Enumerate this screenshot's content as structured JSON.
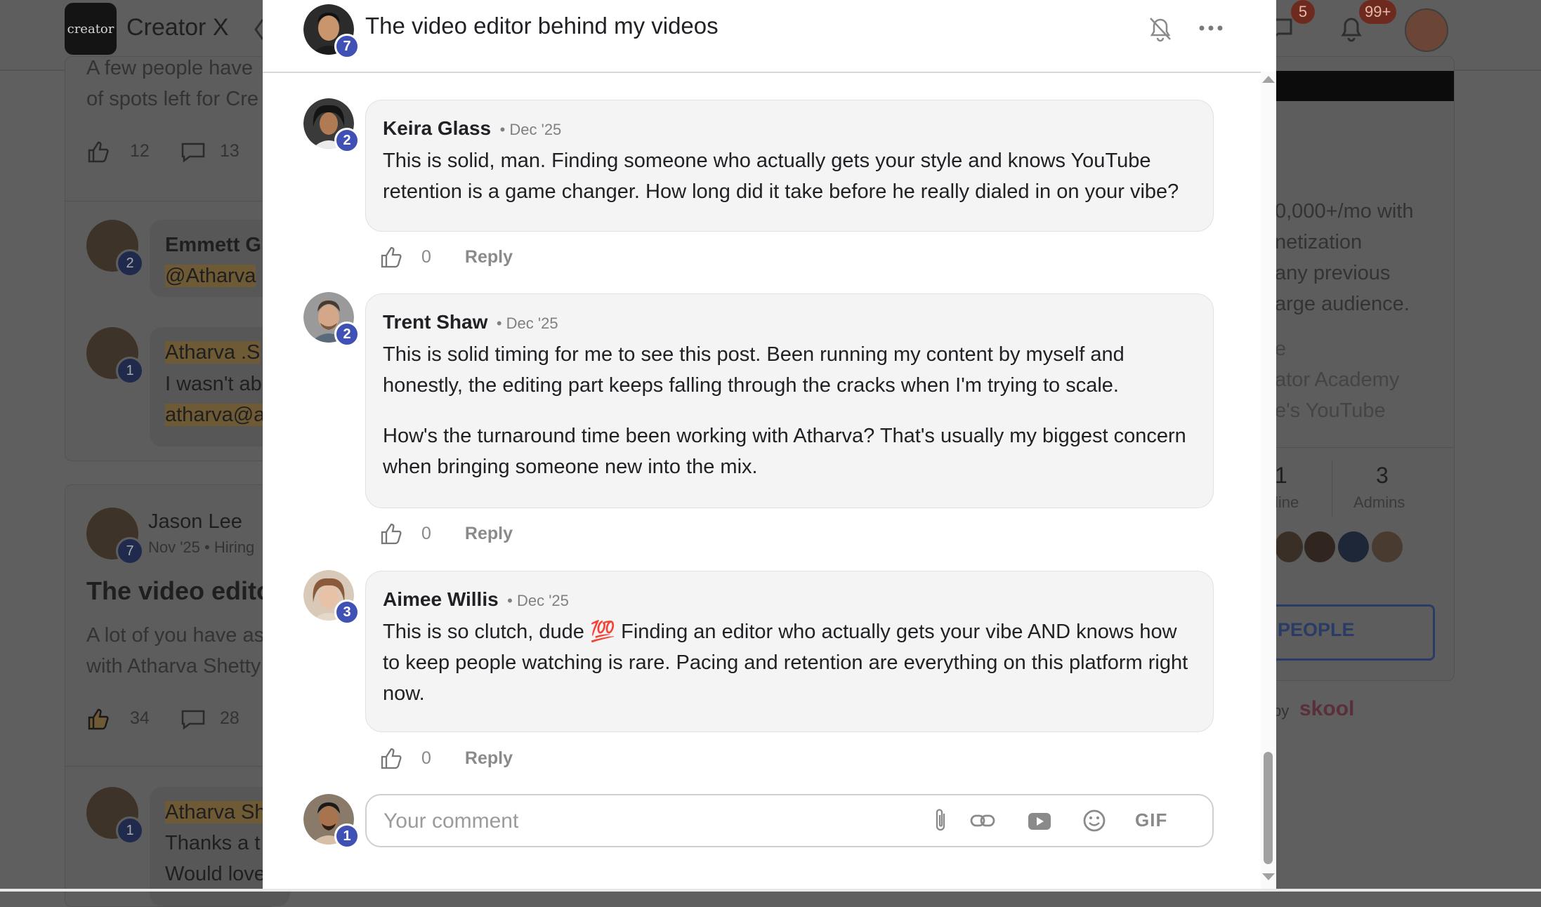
{
  "background": {
    "brand": "Creator X",
    "logo_text": "creator",
    "badges": {
      "chat_count": "5",
      "notif_count": "99+"
    },
    "left_posts": {
      "snippet_line1": "A few people have",
      "snippet_line2": "of spots left for Cre",
      "post1_likes": "12",
      "post1_comments": "13",
      "comment1_author": "Emmett Gl",
      "comment1_mention": "@Atharva",
      "comment1_level": "2",
      "comment2_author": "Atharva .S",
      "comment2_text": "I wasn't ab",
      "comment2_email": "atharva@a",
      "comment2_level": "1",
      "post2_author": "Jason Lee",
      "post2_meta": "Nov '25 • Hiring",
      "post2_level": "7",
      "post2_title": "The video edito",
      "post2_line1": "A lot of you have as",
      "post2_line2": "with Atharva Shetty",
      "post2_likes": "34",
      "post2_comments": "28",
      "comment3_author": "Atharva Sh",
      "comment3_line1": "Thanks a t",
      "comment3_line2": "Would love",
      "comment3_level": "1"
    },
    "right_panel": {
      "line1": "0,000+/mo with",
      "line2": "netization",
      "line3": "any previous",
      "line4": "arge audience.",
      "link1": "e",
      "link2": "ator Academy",
      "link3": "e's YouTube",
      "stat_online_value": "1",
      "stat_online_label": "line",
      "stat_admins_value": "3",
      "stat_admins_label": "Admins",
      "invite_button": "PEOPLE",
      "powered_by": "by",
      "skool": "skool"
    }
  },
  "modal": {
    "title": "The video editor behind my videos",
    "author_level": "7",
    "comments": [
      {
        "name": "Keira Glass",
        "date": "• Dec '25",
        "level": "2",
        "lines": [
          "This is solid, man. Finding someone who actually gets your style and knows YouTube",
          "retention is a game changer. How long did it take before he really dialed in on your vibe?"
        ],
        "likes": "0",
        "reply": "Reply"
      },
      {
        "name": "Trent Shaw",
        "date": "• Dec '25",
        "level": "2",
        "lines": [
          "This is solid timing for me to see this post. Been running my content by myself and",
          "honestly, the editing part keeps falling through the cracks when I'm trying to scale."
        ],
        "lines2": [
          "How's the turnaround time been working with Atharva? That's usually my biggest concern",
          "when bringing someone new into the mix."
        ],
        "likes": "0",
        "reply": "Reply"
      },
      {
        "name": "Aimee Willis",
        "date": "• Dec '25",
        "level": "3",
        "lines": [
          "This is so clutch, dude 💯 Finding an editor who actually gets your vibe AND knows how",
          "to keep people watching is rare. Pacing and retention are everything on this platform right",
          "now."
        ],
        "likes": "0",
        "reply": "Reply"
      }
    ],
    "composer": {
      "placeholder": "Your comment",
      "level": "1",
      "gif_label": "GIF"
    }
  }
}
